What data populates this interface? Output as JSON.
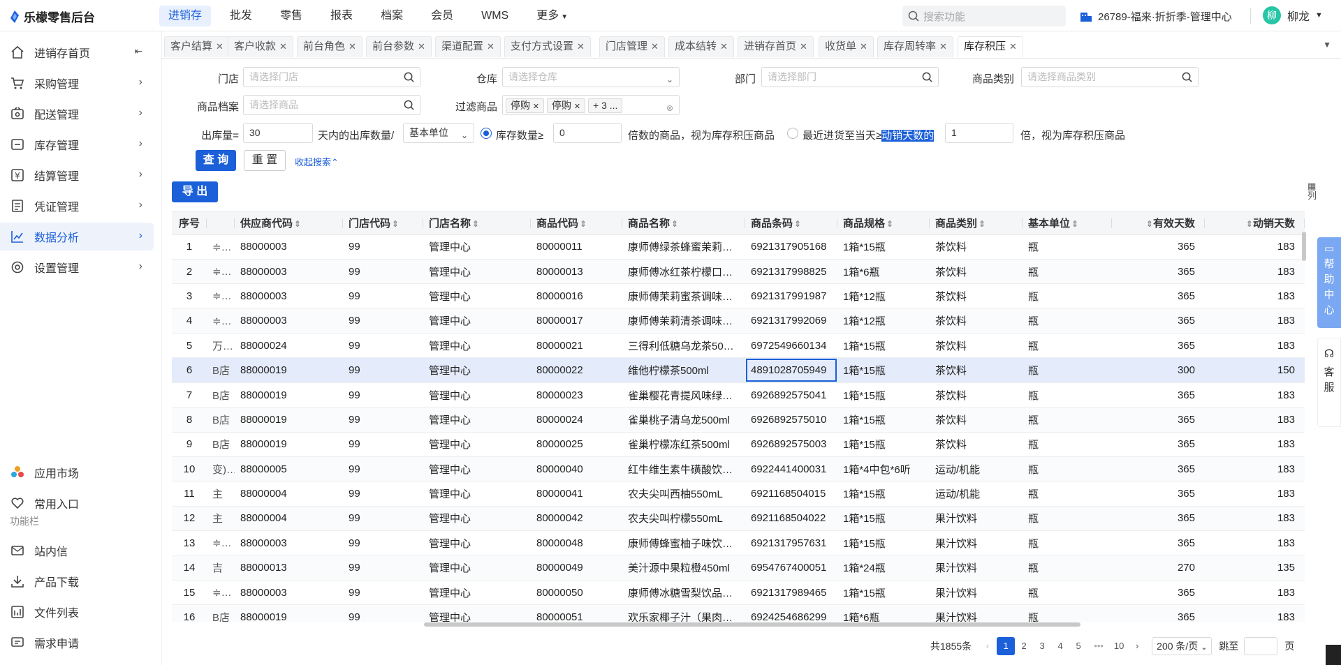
{
  "app": {
    "title": "乐檬零售后台"
  },
  "nav": {
    "items": [
      "进销存",
      "批发",
      "零售",
      "报表",
      "档案",
      "会员",
      "WMS",
      "更多"
    ],
    "active": "进销存"
  },
  "search": {
    "placeholder": "搜索功能"
  },
  "store": {
    "label": "26789-福来·折折季-管理中心"
  },
  "user": {
    "avatar": "柳",
    "name": "柳龙"
  },
  "sidebar": {
    "items": [
      {
        "label": "进销存首页",
        "icon": "home-icon"
      },
      {
        "label": "采购管理",
        "icon": "cart-icon"
      },
      {
        "label": "配送管理",
        "icon": "delivery-icon"
      },
      {
        "label": "库存管理",
        "icon": "inventory-icon"
      },
      {
        "label": "结算管理",
        "icon": "settlement-icon"
      },
      {
        "label": "凭证管理",
        "icon": "voucher-icon"
      },
      {
        "label": "数据分析",
        "icon": "chart-icon"
      },
      {
        "label": "设置管理",
        "icon": "settings-icon"
      }
    ],
    "active": "数据分析",
    "bottom": [
      {
        "label": "应用市场",
        "icon": "app-market-icon"
      },
      {
        "label": "常用入口",
        "icon": "heart-icon"
      }
    ],
    "section_title": "功能栏",
    "tools": [
      {
        "label": "站内信",
        "icon": "mail-icon"
      },
      {
        "label": "产品下载",
        "icon": "download-icon"
      },
      {
        "label": "文件列表",
        "icon": "file-list-icon"
      },
      {
        "label": "需求申请",
        "icon": "request-icon"
      }
    ]
  },
  "tabs": [
    "客户结算",
    "客户收款",
    "前台角色",
    "前台参数",
    "渠道配置",
    "支付方式设置",
    "门店管理",
    "成本结转",
    "进销存首页",
    "收货单",
    "库存周转率",
    "库存积压"
  ],
  "active_tab": "库存积压",
  "filters": {
    "store": {
      "label": "门店",
      "placeholder": "请选择门店"
    },
    "warehouse": {
      "label": "仓库",
      "placeholder": "请选择仓库"
    },
    "dept": {
      "label": "部门",
      "placeholder": "请选择部门"
    },
    "category": {
      "label": "商品类别",
      "placeholder": "请选择商品类别"
    },
    "product": {
      "label": "商品档案",
      "placeholder": "请选择商品"
    },
    "filter_goods": {
      "label": "过滤商品",
      "chips": [
        "停购",
        "停购",
        "+ 3 ..."
      ]
    },
    "out_qty_label": "出库量=",
    "days_value": "30",
    "days_text": "天内的出库数量/",
    "unit_value": "基本单位",
    "stock_radio_label": "库存数量≥",
    "stock_value": "0",
    "stock_suffix": "倍数的商品，视为库存积压商品",
    "recent_radio_label_a": "最近进货至当天≥",
    "recent_radio_label_b": "动销天数的",
    "recent_value": "1",
    "recent_suffix": "倍，视为库存积压商品",
    "query_btn": "查 询",
    "reset_btn": "重 置",
    "collapse_link": "收起搜索",
    "export_btn": "导 出"
  },
  "table": {
    "columns": [
      "序号",
      "",
      "供应商代码",
      "门店代码",
      "门店名称",
      "商品代码",
      "商品名称",
      "商品条码",
      "商品规格",
      "商品类别",
      "基本单位",
      "有效天数",
      "动销天数"
    ],
    "rows": [
      [
        "1",
        "≑…",
        "88000003",
        "99",
        "管理中心",
        "80000011",
        "康师傅绿茶蜂蜜茉莉…",
        "6921317905168",
        "1箱*15瓶",
        "茶饮料",
        "瓶",
        "365",
        "183"
      ],
      [
        "2",
        "≑…",
        "88000003",
        "99",
        "管理中心",
        "80000013",
        "康师傅冰红茶柠檬口…",
        "6921317998825",
        "1箱*6瓶",
        "茶饮料",
        "瓶",
        "365",
        "183"
      ],
      [
        "3",
        "≑…",
        "88000003",
        "99",
        "管理中心",
        "80000016",
        "康师傅茉莉蜜茶调味…",
        "6921317991987",
        "1箱*12瓶",
        "茶饮料",
        "瓶",
        "365",
        "183"
      ],
      [
        "4",
        "≑…",
        "88000003",
        "99",
        "管理中心",
        "80000017",
        "康师傅茉莉清茶调味…",
        "6921317992069",
        "1箱*12瓶",
        "茶饮料",
        "瓶",
        "365",
        "183"
      ],
      [
        "5",
        "万…",
        "88000024",
        "99",
        "管理中心",
        "80000021",
        "三得利低糖乌龙茶50…",
        "6972549660134",
        "1箱*15瓶",
        "茶饮料",
        "瓶",
        "365",
        "183"
      ],
      [
        "6",
        "B店",
        "88000019",
        "99",
        "管理中心",
        "80000022",
        "维他柠檬茶500ml",
        "4891028705949",
        "1箱*15瓶",
        "茶饮料",
        "瓶",
        "300",
        "150"
      ],
      [
        "7",
        "B店",
        "88000019",
        "99",
        "管理中心",
        "80000023",
        "雀巢樱花青提风味绿…",
        "6926892575041",
        "1箱*15瓶",
        "茶饮料",
        "瓶",
        "365",
        "183"
      ],
      [
        "8",
        "B店",
        "88000019",
        "99",
        "管理中心",
        "80000024",
        "雀巢桃子清乌龙500ml",
        "6926892575010",
        "1箱*15瓶",
        "茶饮料",
        "瓶",
        "365",
        "183"
      ],
      [
        "9",
        "B店",
        "88000019",
        "99",
        "管理中心",
        "80000025",
        "雀巢柠檬冻红茶500ml",
        "6926892575003",
        "1箱*15瓶",
        "茶饮料",
        "瓶",
        "365",
        "183"
      ],
      [
        "10",
        "变)…",
        "88000005",
        "99",
        "管理中心",
        "80000040",
        "红牛维生素牛磺酸饮…",
        "6922441400031",
        "1箱*4中包*6听",
        "运动/机能",
        "瓶",
        "365",
        "183"
      ],
      [
        "11",
        "主",
        "88000004",
        "99",
        "管理中心",
        "80000041",
        "农夫尖叫西柚550mL",
        "6921168504015",
        "1箱*15瓶",
        "运动/机能",
        "瓶",
        "365",
        "183"
      ],
      [
        "12",
        "主",
        "88000004",
        "99",
        "管理中心",
        "80000042",
        "农夫尖叫柠檬550mL",
        "6921168504022",
        "1箱*15瓶",
        "果汁饮料",
        "瓶",
        "365",
        "183"
      ],
      [
        "13",
        "≑…",
        "88000003",
        "99",
        "管理中心",
        "80000048",
        "康师傅蜂蜜柚子味饮…",
        "6921317957631",
        "1箱*15瓶",
        "果汁饮料",
        "瓶",
        "365",
        "183"
      ],
      [
        "14",
        "吉",
        "88000013",
        "99",
        "管理中心",
        "80000049",
        "美汁源中果粒橙450ml",
        "6954767400051",
        "1箱*24瓶",
        "果汁饮料",
        "瓶",
        "270",
        "135"
      ],
      [
        "15",
        "≑…",
        "88000003",
        "99",
        "管理中心",
        "80000050",
        "康师傅冰糖雪梨饮品…",
        "6921317989465",
        "1箱*15瓶",
        "果汁饮料",
        "瓶",
        "365",
        "183"
      ],
      [
        "16",
        "B店",
        "88000019",
        "99",
        "管理中心",
        "80000051",
        "欢乐家椰子汁（果肉…",
        "6924254686299",
        "1箱*6瓶",
        "果汁饮料",
        "瓶",
        "365",
        "183"
      ]
    ],
    "selected_row": 6,
    "column_setting": "列"
  },
  "pager": {
    "total": "共1855条",
    "pages": [
      "1",
      "2",
      "3",
      "4",
      "5",
      "•••",
      "10"
    ],
    "current": "1",
    "page_size": "200 条/页",
    "jump_label": "跳至",
    "page_suffix": "页"
  },
  "help": {
    "label": "帮助中心"
  },
  "service": {
    "label": "客服"
  }
}
